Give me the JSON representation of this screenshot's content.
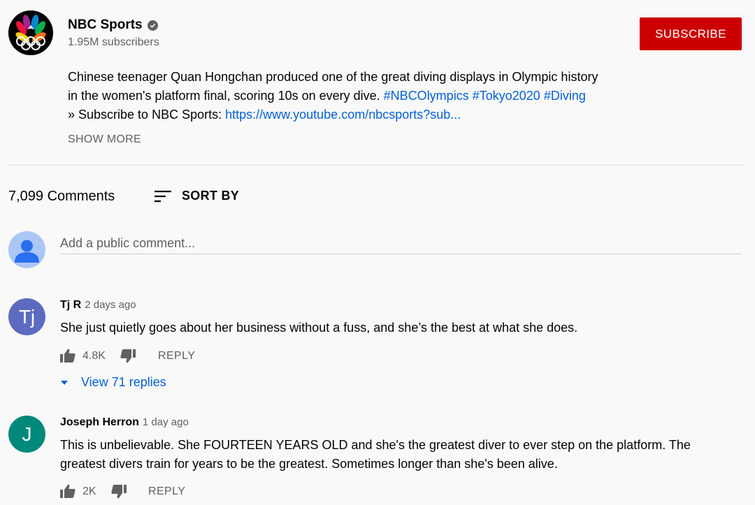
{
  "channel": {
    "logo_icon": "nbc-peacock-olympic-rings-logo",
    "name": "NBC Sports",
    "verified_icon": "checkmark-icon",
    "subscribers": "1.95M subscribers",
    "subscribe_label": "SUBSCRIBE",
    "subscribe_color": "#cc0000"
  },
  "description": {
    "line1": "Chinese teenager Quan Hongchan produced one of the great diving displays in Olympic history",
    "line2": "in the women's platform final, scoring 10s on every dive.",
    "hashtags": [
      "#NBCOlympics",
      "#Tokyo2020",
      "#Diving"
    ],
    "line3_prefix": "» Subscribe to NBC Sports: ",
    "line3_link": "https://www.youtube.com/nbcsports?sub...",
    "show_more": "SHOW MORE"
  },
  "comments_header": {
    "count": "7,099 Comments",
    "sort_icon": "sort-icon",
    "sort_label": "SORT BY"
  },
  "add_comment": {
    "placeholder": "Add a public comment..."
  },
  "comments": [
    {
      "avatar_text": "Tj",
      "avatar_color": "#5c6bc0",
      "author": "Tj R",
      "time": "2 days ago",
      "text": "She just quietly goes about her business without a fuss, and she’s the best at what she does.",
      "likes": "4.8K",
      "reply_label": "REPLY",
      "view_replies": "View 71 replies"
    },
    {
      "avatar_text": "J",
      "avatar_color": "#00897b",
      "author": "Joseph Herron",
      "time": "1 day ago",
      "text_line1": "This is unbelievable. She FOURTEEN YEARS OLD and she's the greatest diver to ever step on the platform. The",
      "text_line2": "greatest divers train for years to be the greatest. Sometimes longer than she's been alive.",
      "likes": "2K",
      "reply_label": "REPLY"
    }
  ]
}
